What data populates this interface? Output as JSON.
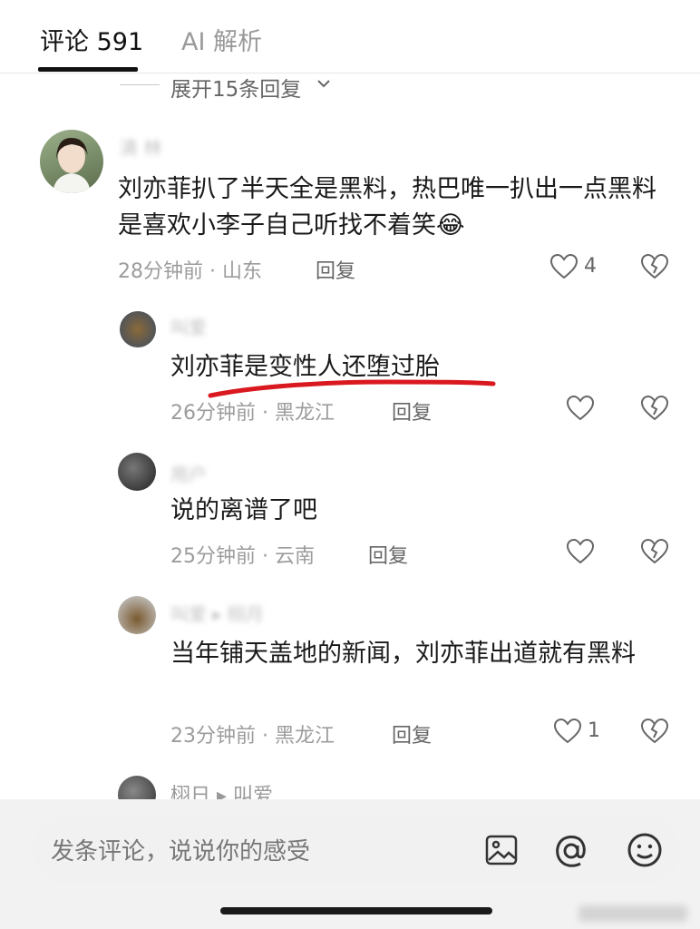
{
  "tabs": {
    "comments": "评论 591",
    "ai": "AI 解析"
  },
  "expand": {
    "label": "展开15条回复"
  },
  "comments": [
    {
      "name": "清 林",
      "text": "刘亦菲扒了半天全是黑料，热巴唯一扒出一点黑料是喜欢小李子自己听找不着笑😂",
      "time": "28分钟前",
      "location": "山东",
      "reply": "回复",
      "likes": "4"
    },
    {
      "name": "叫爱",
      "text": "刘亦菲是变性人还堕过胎",
      "time": "26分钟前",
      "location": "黑龙江",
      "reply": "回复",
      "likes": ""
    },
    {
      "name": "用户",
      "text": "说的离谱了吧",
      "time": "25分钟前",
      "location": "云南",
      "reply": "回复",
      "likes": ""
    },
    {
      "name": "叫爱 ▸ 栩月",
      "text": "当年铺天盖地的新闻，刘亦菲出道就有黑料",
      "time": "23分钟前",
      "location": "黑龙江",
      "reply": "回复",
      "likes": "1"
    },
    {
      "name": "栩日 ▸ 叫爱"
    }
  ],
  "input": {
    "placeholder": "发条评论，说说你的感受"
  },
  "icons": [
    "chevron-down-icon",
    "heart-icon",
    "broken-heart-icon",
    "image-icon",
    "at-icon",
    "emoji-icon"
  ],
  "colors": {
    "underline": "#d9191f",
    "tab_active": "#111111",
    "meta": "#9c9c9c"
  }
}
